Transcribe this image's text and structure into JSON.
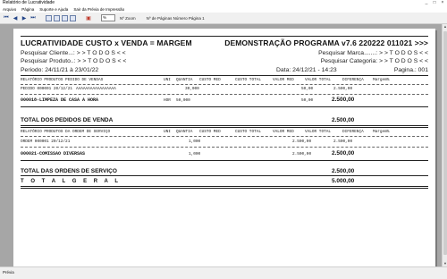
{
  "window": {
    "title": "Relatório de Lucratividade",
    "controls": [
      "_",
      "□",
      "×"
    ]
  },
  "menu": [
    "Arquivo",
    "Página",
    "Suporte e Ajuda",
    "Sair da Prévia de Impressão"
  ],
  "toolbar": {
    "zoom_value": "%",
    "zoom_label": "Nº Zoom",
    "pages_text": "Nº de Páginas  Número Página  1"
  },
  "report": {
    "title_left": "LUCRATIVIDADE CUSTO x VENDA = MARGEM",
    "title_right": "DEMONSTRAÇÃO PROGRAMA v7.6 220222 011021 >>>",
    "filter_cliente": "Pesquisar Cliente...: > > T O D O S < <",
    "filter_produto": "Pesquisar Produto..: > > T O D O S < <",
    "filter_marca": "Pesquisar Marca.......: > > T O D O S < <",
    "filter_categoria": "Pesquisar Categoria: > > T O D O S < <",
    "periodo": "Periodo: 24/11/21 à 23/01/22",
    "data": "Data: 24/12/21 - 14:23",
    "pagina": "Pagina.: 001",
    "section_vendas": {
      "header": "RELATÓRIO PRODUTOS PEDIDO DE VENDAS",
      "columns": [
        "UNI",
        "QUANTIA",
        "CUSTO MED",
        "CUSTO TOTAL",
        "VALOR MED",
        "VALOR TOTAL",
        "DIFERENÇA",
        "Margem%"
      ],
      "order_line": {
        "label": "PEDIDO 000001  20/12/21",
        "name": "AAAAAAAAAAAAAAAAA",
        "quantia": "30,000",
        "valor_med": "50,00",
        "valor_total": "2.500,00"
      },
      "item_line": {
        "code": "000018-LIMPEZA DE CASA A HORA",
        "uni": "HOR",
        "quantia": "50,000",
        "valor_med": "50,00",
        "valor_total": "2.500,00"
      },
      "total_label": "TOTAL DOS PEDIDOS DE VENDA",
      "total_value": "2.500,00"
    },
    "section_servicos": {
      "header": "RELATÓRIO PRODUTOS DA ORDEM DE SERVIÇO",
      "columns": [
        "UNI",
        "QUANTIA",
        "CUSTO MED",
        "CUSTO TOTAL",
        "VALOR MED",
        "VALOR TOTAL",
        "DIFERENÇA",
        "Margem%"
      ],
      "order_line": {
        "label": "ORDEM  000001  20/12/21",
        "quantia": "1,000",
        "valor_med": "2.500,00",
        "valor_total": "2.500,00"
      },
      "item_line": {
        "code": "000021-COMISSAO DIVERSAS",
        "quantia": "1,000",
        "valor_med": "2.500,00",
        "valor_total": "2.500,00"
      },
      "total_label": "TOTAL DAS ORDENS DE SERVIÇO",
      "total_value": "2.500,00"
    },
    "geral_label": "T O T A L   G E R A L",
    "geral_value": "5.000,00"
  },
  "statusbar": {
    "text": "Prévia"
  }
}
